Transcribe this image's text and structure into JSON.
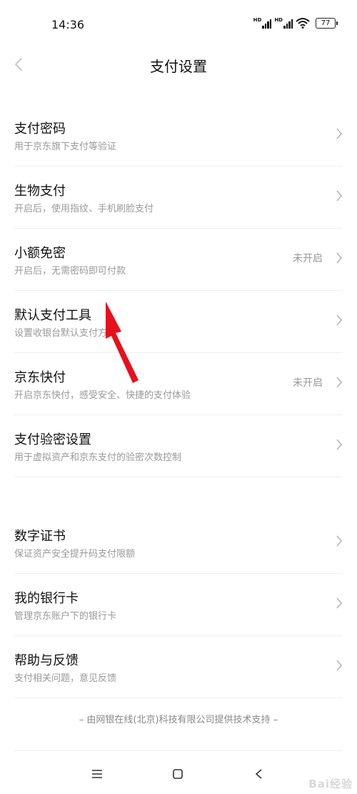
{
  "status_bar": {
    "time": "14:36",
    "network_label": "HD",
    "battery": "77"
  },
  "header": {
    "back_icon": "chevron-left-icon",
    "title": "支付设置"
  },
  "section1": [
    {
      "title": "支付密码",
      "subtitle": "用于京东旗下支付等验证",
      "value": ""
    },
    {
      "title": "生物支付",
      "subtitle": "开启后，使用指纹、手机刷脸支付",
      "value": ""
    },
    {
      "title": "小额免密",
      "subtitle": "开启后，无需密码即可付款",
      "value": "未开启"
    },
    {
      "title": "默认支付工具",
      "subtitle": "设置收银台默认支付方式",
      "value": ""
    },
    {
      "title": "京东快付",
      "subtitle": "开启京东快付，感受安全、快捷的支付体验",
      "value": "未开启"
    },
    {
      "title": "支付验密设置",
      "subtitle": "用于虚拟资产和京东支付的验密次数控制",
      "value": ""
    }
  ],
  "section2": [
    {
      "title": "数字证书",
      "subtitle": "保证资产安全提升码支付限额",
      "value": ""
    },
    {
      "title": "我的银行卡",
      "subtitle": "管理京东账户下的银行卡",
      "value": ""
    },
    {
      "title": "帮助与反馈",
      "subtitle": "支付相关问题，意见反馈",
      "value": ""
    }
  ],
  "footer": {
    "note": "– 由网银在线(北京)科技有限公司提供技术支持 –"
  },
  "watermark": "Bai经验",
  "colors": {
    "annotation_arrow": "#e8101c",
    "chevron": "#b5b5b5",
    "subtitle": "#999999"
  }
}
